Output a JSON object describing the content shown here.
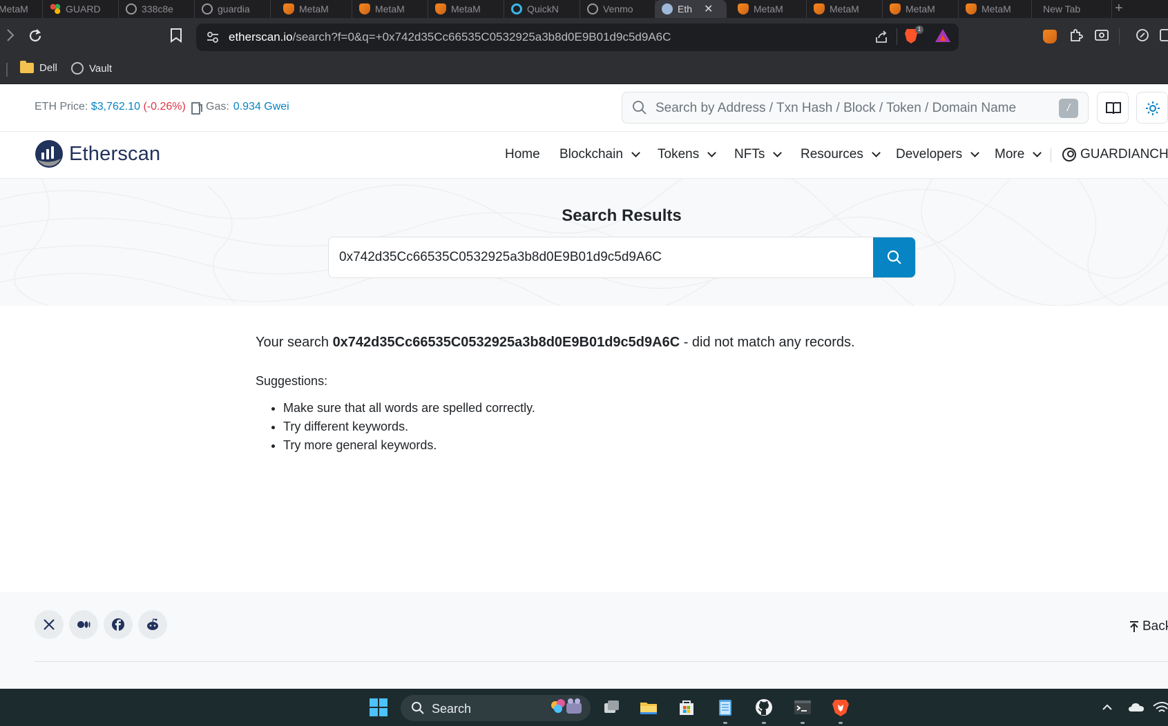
{
  "browser": {
    "tabs": [
      {
        "label": "MetaM",
        "icon": "metamask-icon"
      },
      {
        "label": "GUARD",
        "icon": "grid-icon"
      },
      {
        "label": "338c8e",
        "icon": "globe-icon"
      },
      {
        "label": "guardia",
        "icon": "globe-icon"
      },
      {
        "label": "MetaM",
        "icon": "metamask-icon"
      },
      {
        "label": "MetaM",
        "icon": "metamask-icon"
      },
      {
        "label": "MetaM",
        "icon": "metamask-icon"
      },
      {
        "label": "QuickN",
        "icon": "quicknode-icon"
      },
      {
        "label": "Venmo",
        "icon": "venmo-icon"
      },
      {
        "label": "Eth",
        "icon": "etherscan-icon",
        "active": true
      },
      {
        "label": "MetaM",
        "icon": "metamask-icon"
      },
      {
        "label": "MetaM",
        "icon": "metamask-icon"
      },
      {
        "label": "MetaM",
        "icon": "metamask-icon"
      },
      {
        "label": "MetaM",
        "icon": "metamask-icon"
      },
      {
        "label": "New Tab",
        "icon": ""
      }
    ],
    "url_host": "etherscan.io",
    "url_path": "/search?f=0&q=+0x742d35Cc66535C0532925a3b8d0E9B01d9c5d9A6C",
    "shields_count": "1",
    "bookmarks": [
      {
        "label": "Dell",
        "icon": "folder-icon"
      },
      {
        "label": "Vault",
        "icon": "globe-icon"
      }
    ]
  },
  "site": {
    "eth_price_label": "ETH Price:",
    "eth_price_value": "$3,762.10",
    "eth_price_change": "(-0.26%)",
    "gas_label": "Gas:",
    "gas_value": "0.934 Gwei",
    "search_placeholder": "Search by Address / Txn Hash / Block / Token / Domain Name",
    "search_shortcut": "/",
    "brand": "Etherscan",
    "nav": {
      "home": "Home",
      "blockchain": "Blockchain",
      "tokens": "Tokens",
      "nfts": "NFTs",
      "resources": "Resources",
      "developers": "Developers",
      "more": "More",
      "user": "GUARDIANCHA"
    },
    "accent_color": "#0784c3"
  },
  "results": {
    "title": "Search Results",
    "query": "0x742d35Cc66535C0532925a3b8d0E9B01d9c5d9A6C",
    "msg_prefix": "Your search",
    "msg_suffix": " - did not match any records.",
    "suggestions_label": "Suggestions:",
    "suggestions": [
      "Make sure that all words are spelled correctly.",
      "Try different keywords.",
      "Try more general keywords."
    ]
  },
  "footer": {
    "back_to_top": "Back",
    "social": [
      "x-icon",
      "medium-icon",
      "facebook-icon",
      "reddit-icon"
    ]
  },
  "taskbar": {
    "search_label": "Search"
  }
}
